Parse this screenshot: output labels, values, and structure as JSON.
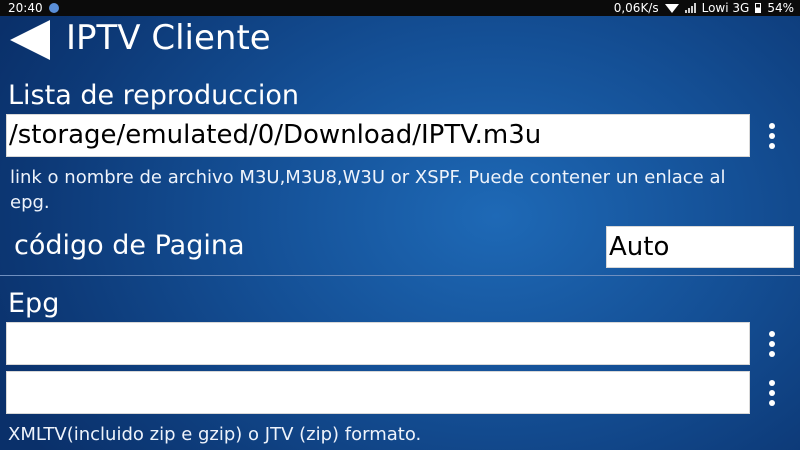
{
  "status_bar": {
    "time": "20:40",
    "network_speed": "0,06K/s",
    "carrier": "Lowi 3G",
    "battery": "54%",
    "icons": [
      "notification-icon",
      "wifi-icon",
      "signal-icon",
      "battery-icon"
    ]
  },
  "header": {
    "title": "IPTV Cliente",
    "back_icon": "back-arrow-icon"
  },
  "playlist": {
    "label": "Lista de reproduccion",
    "url_value": "/storage/emulated/0/Download/IPTV.m3u",
    "hint": "link o nombre de archivo M3U,M3U8,W3U or XSPF. Puede contener un enlace al epg.",
    "page_code_label": "código de Pagina",
    "page_code_value": "Auto"
  },
  "epg": {
    "label": "Epg",
    "field1_value": "",
    "field2_value": "",
    "hint": "XMLTV(incluido zip e gzip) o JTV (zip) formato."
  },
  "colors": {
    "background_center": "#1e69b6",
    "background_edge": "#0a306a",
    "statusbar": "#0b0b0b",
    "field": "#ffffff"
  }
}
